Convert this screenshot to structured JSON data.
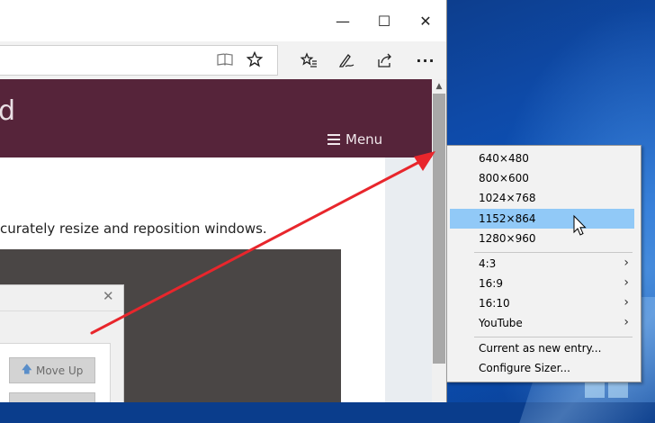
{
  "window": {
    "minimize_glyph": "—",
    "maximize_glyph": "☐",
    "close_glyph": "✕"
  },
  "toolbar": {
    "reading_view_icon": "book-icon",
    "favorite_icon": "star-icon",
    "favorites_hub_icon": "favorites-list-icon",
    "notes_icon": "pen-icon",
    "share_icon": "share-icon",
    "more_label": "···"
  },
  "page": {
    "banner_title": "d",
    "menu_label": "Menu",
    "body_text": "curately resize and reposition windows.",
    "inner_dialog": {
      "close_glyph": "✕",
      "move_up_label": "Move Up"
    }
  },
  "context_menu": {
    "resolutions": [
      "640×480",
      "800×600",
      "1024×768",
      "1152×864",
      "1280×960"
    ],
    "highlighted_index": 3,
    "ratios": [
      "4:3",
      "16:9",
      "16:10",
      "YouTube"
    ],
    "actions": [
      "Current as new entry...",
      "Configure Sizer..."
    ]
  },
  "colors": {
    "banner": "#56243a",
    "highlight": "#91c9f7",
    "arrow": "#e8262c"
  }
}
